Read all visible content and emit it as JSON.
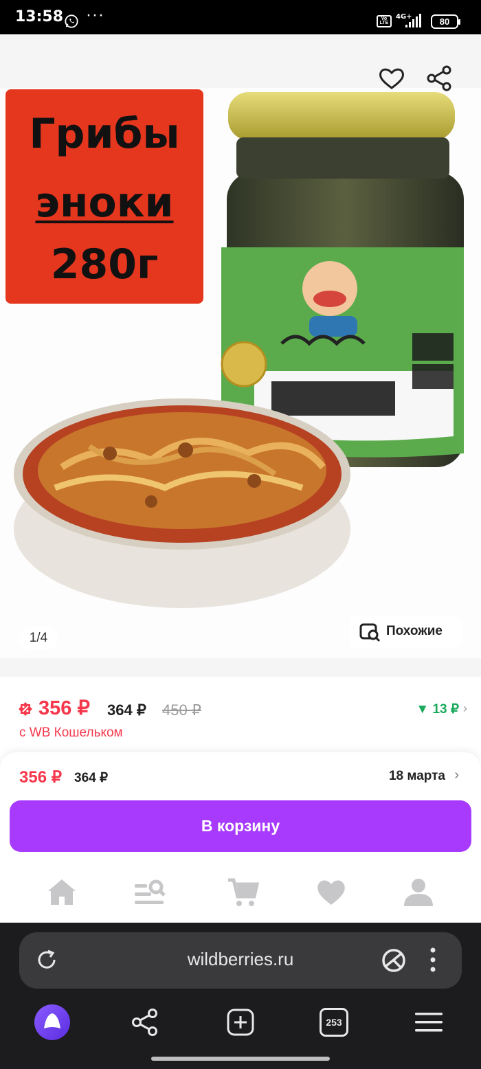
{
  "status_bar": {
    "time": "13:58",
    "more": "···",
    "network_badge": "Vo LTE",
    "network_type": "4G+",
    "battery": "80"
  },
  "gallery": {
    "promo": {
      "line1": "Грибы",
      "line2": "эноки",
      "line3": "280г"
    },
    "counter": "1/4",
    "similar_label": "Похожие"
  },
  "price": {
    "wallet_price": "356 ₽",
    "price": "364 ₽",
    "old_price": "450 ₽",
    "wallet_note": "с WB Кошельком",
    "cashback": "13 ₽"
  },
  "sticky": {
    "wallet_price": "356 ₽",
    "price": "364 ₽",
    "delivery_date": "18 марта",
    "cart_button": "В корзину"
  },
  "app_nav": [
    "home-icon",
    "catalog-search-icon",
    "cart-icon",
    "favorites-icon",
    "profile-icon"
  ],
  "browser": {
    "url": "wildberries.ru",
    "tabs_count": "253"
  },
  "colors": {
    "accent": "#a73afd",
    "price_red": "#f5384c",
    "cashback_green": "#1aaa5c",
    "promo_red": "#e5361e"
  }
}
